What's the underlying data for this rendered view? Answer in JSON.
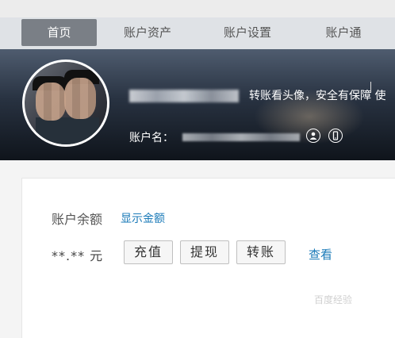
{
  "nav": {
    "tabs": [
      {
        "label": "首页",
        "active": true
      },
      {
        "label": "账户资产",
        "active": false
      },
      {
        "label": "账户设置",
        "active": false
      },
      {
        "label": "账户通",
        "active": false
      }
    ]
  },
  "profile": {
    "slogan": "转账看头像，安全有保障 使",
    "account_label": "账户名：",
    "icons": [
      "user-icon",
      "phone-icon"
    ],
    "separator": "|"
  },
  "balance": {
    "label": "账户余额",
    "show_link": "显示金额",
    "amount": "**.** 元",
    "buttons": [
      "充值",
      "提现",
      "转账"
    ],
    "view_link": "查看"
  },
  "watermark": "百度经验",
  "colors": {
    "link": "#1a7ab8",
    "active_tab": "#7a7f86"
  }
}
